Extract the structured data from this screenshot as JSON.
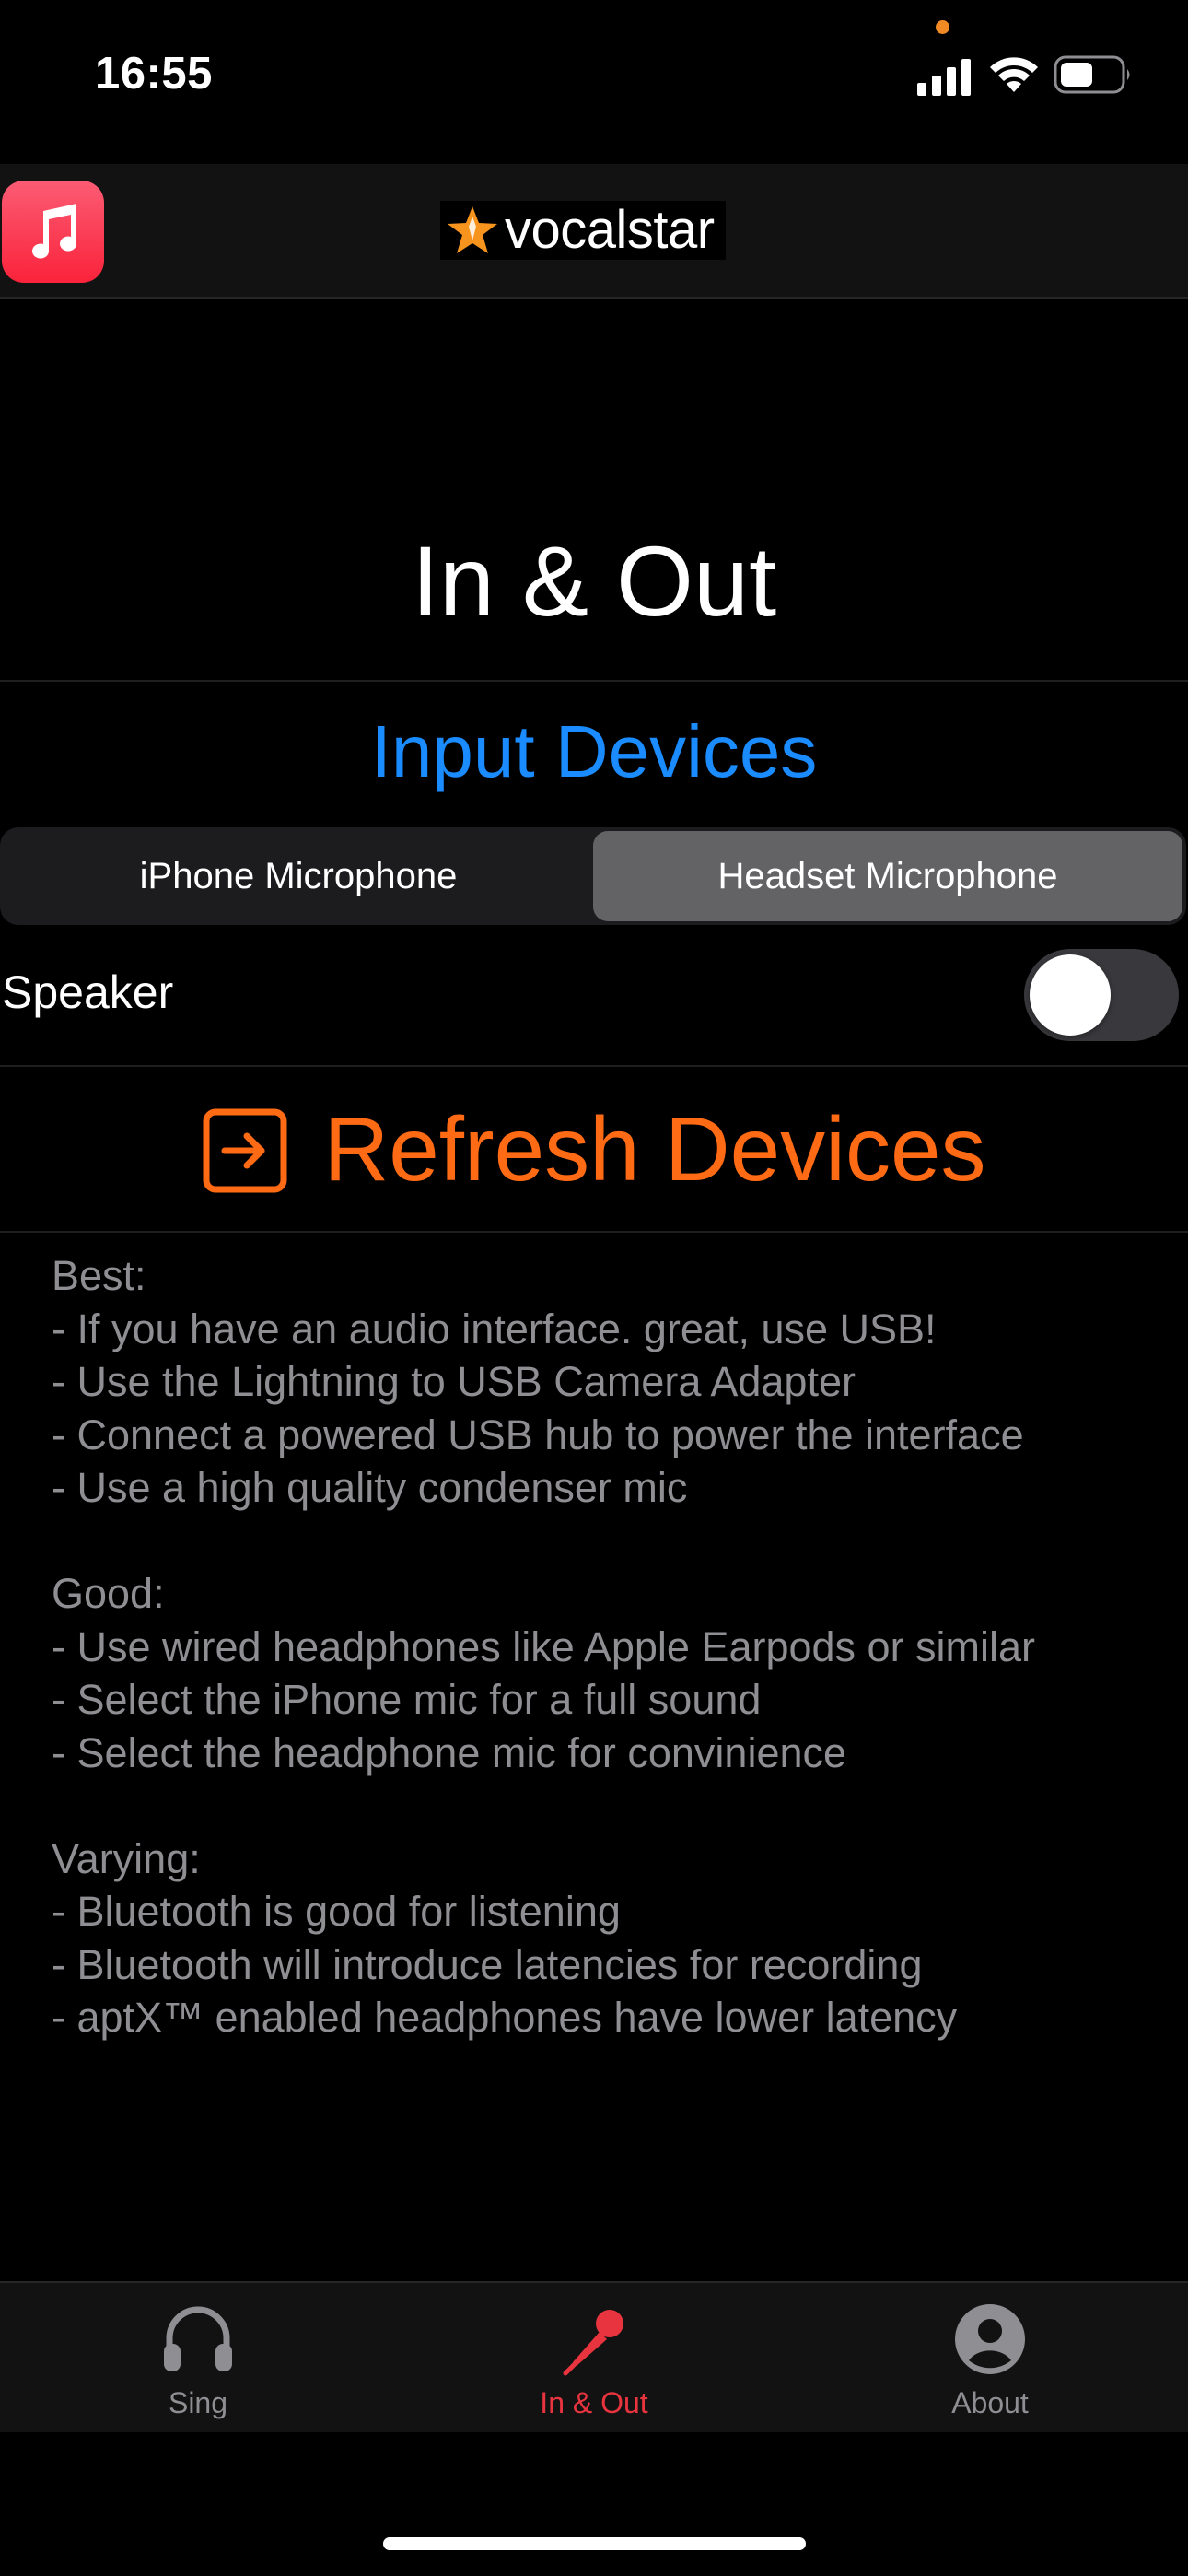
{
  "status_bar": {
    "time": "16:55",
    "icons": [
      "cellular-signal-icon",
      "wifi-icon",
      "battery-icon"
    ],
    "privacy_indicator_color": "#f08a24"
  },
  "header": {
    "app_icon": "music-note-icon",
    "logo_text": "vocalstar",
    "logo_icon": "star-icon"
  },
  "main": {
    "title": "In & Out",
    "input_devices": {
      "title": "Input Devices",
      "options": [
        "iPhone Microphone",
        "Headset Microphone"
      ],
      "selected": "Headset Microphone"
    },
    "speaker": {
      "label": "Speaker",
      "enabled": false
    },
    "refresh": {
      "label": "Refresh Devices",
      "icon": "arrow-right-square-icon"
    },
    "tips": {
      "best": [
        "Best:",
        "- If you have an audio interface. great, use USB!",
        "- Use the Lightning to USB Camera Adapter",
        "- Connect a powered USB hub to power the interface",
        "- Use a high quality condenser mic"
      ],
      "good": [
        "Good:",
        "- Use wired headphones like Apple Earpods or similar",
        "- Select the iPhone mic for a full sound",
        "- Select the headphone mic for convinience"
      ],
      "varying": [
        "Varying:",
        "- Bluetooth is good for listening",
        "- Bluetooth will introduce latencies for recording",
        "- aptX™ enabled headphones have lower latency"
      ]
    }
  },
  "tab_bar": {
    "tabs": [
      {
        "label": "Sing",
        "icon": "headphones-icon",
        "active": false
      },
      {
        "label": "In & Out",
        "icon": "microphone-icon",
        "active": true
      },
      {
        "label": "About",
        "icon": "person-circle-icon",
        "active": false
      }
    ]
  },
  "colors": {
    "accent_blue": "#1a8cff",
    "accent_orange": "#ff6a14",
    "active_tab_red": "#e8343f",
    "muted_text": "#8e8e93"
  }
}
